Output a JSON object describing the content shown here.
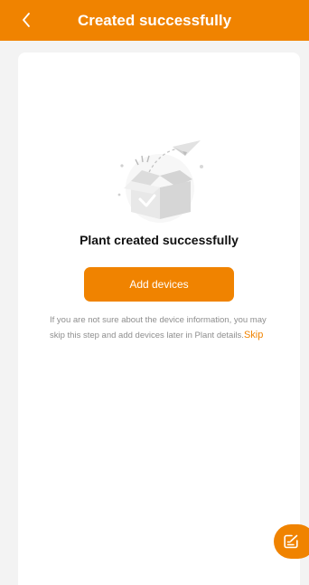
{
  "header": {
    "title": "Created successfully"
  },
  "main": {
    "success_message": "Plant created successfully",
    "add_devices_label": "Add devices",
    "hint_text": "If you are not sure about the device information, you may skip this step and add devices later in Plant details.",
    "skip_label": "Skip"
  },
  "icons": {
    "back": "chevron-left-icon",
    "illustration": "box-paper-plane-illustration",
    "fab": "feedback-icon"
  },
  "colors": {
    "accent": "#f08300",
    "hint_text": "#8e8e8e",
    "background": "#f3f3f3"
  }
}
